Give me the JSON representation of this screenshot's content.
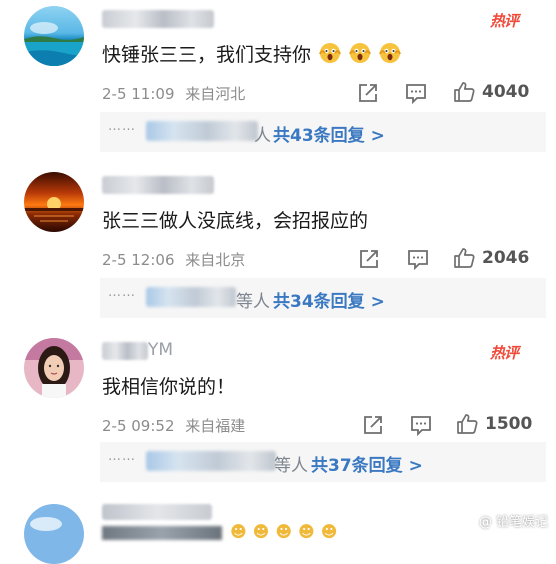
{
  "colors": {
    "hot": "#f04a3a",
    "link": "#3a79c2",
    "meta": "#8c8c8c"
  },
  "comments": [
    {
      "hot_label": "热评",
      "text": "快锤张三三，我们支持你",
      "emojis": [
        "scream-emoji",
        "scream-emoji",
        "scream-emoji"
      ],
      "date": "2-5 11:09",
      "location": "来自河北",
      "likes": "4040",
      "reply_people_suffix": "人",
      "reply_total": "共43条回复 >"
    },
    {
      "hot_label": "",
      "text": "张三三做人没底线，会招报应的",
      "emojis": [],
      "date": "2-5 12:06",
      "location": "来自北京",
      "likes": "2046",
      "reply_people_suffix": "等人",
      "reply_total": "共34条回复 >"
    },
    {
      "hot_label": "热评",
      "username_tail": "YM",
      "text": "我相信你说的！",
      "emojis": [],
      "date": "2-5 09:52",
      "location": "来自福建",
      "likes": "1500",
      "reply_people_suffix": "等人",
      "reply_total": "共37条回复 >"
    }
  ],
  "reply_dots": "……",
  "watermark": "@ 铅笔娱记"
}
